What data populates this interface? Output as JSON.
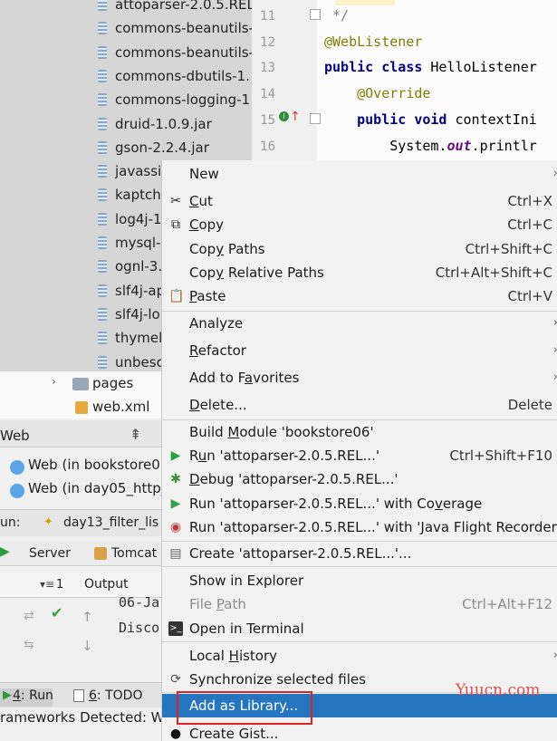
{
  "project_tree": {
    "jars": [
      "attoparser-2.0.5.REL",
      "commons-beanutils-",
      "commons-beanutils-",
      "commons-dbutils-1.",
      "commons-logging-1",
      "druid-1.0.9.jar",
      "gson-2.2.4.jar",
      "javassis",
      "kaptch",
      "log4j-1",
      "mysql-",
      "ognl-3.",
      "slf4j-ap",
      "slf4j-lo",
      "thymel",
      "unbesc"
    ],
    "pages_folder": "pages",
    "web_xml": "web.xml"
  },
  "editor": {
    "line_numbers": [
      "11",
      "12",
      "13",
      "14",
      "15",
      "16"
    ],
    "lines": {
      "l11": " */",
      "l12": "@WebListener",
      "l13_kw": "public class ",
      "l13_name": "HelloListener",
      "l14": "    @Override",
      "l15_kw": "    public void ",
      "l15_name": "contextIni",
      "l16_a": "        System.",
      "l16_b": "out",
      "l16_c": ".printlr"
    }
  },
  "services": {
    "web_panel_title": "Web",
    "items": [
      "Web (in bookstore0",
      "Web (in day05_http_"
    ],
    "run_label": "un:",
    "run_config_tab": "day13_filter_lis",
    "server_tab": "Server",
    "tomcat_tab": "Tomcat L",
    "output_tab": "Output",
    "counter": "1",
    "console_lines": [
      "06-Ja",
      "Disco"
    ]
  },
  "bottom_bar": {
    "run_tab_num": "4",
    "run_tab": ": Run",
    "todo_tab_num": "6",
    "todo_tab": ": TODO",
    "status": "rameworks Detected: We"
  },
  "context_menu": {
    "new": "New",
    "cut_u": "C",
    "cut_rest": "ut",
    "cut_sc": "Ctrl+X",
    "copy_u": "C",
    "copy_rest": "opy",
    "copy_sc": "Ctrl+C",
    "copy_paths_a": "Cop",
    "copy_paths_u": "y",
    "copy_paths_b": " Paths",
    "copy_paths_sc": "Ctrl+Shift+C",
    "copy_rel_a": "Cop",
    "copy_rel_u": "y",
    "copy_rel_b": " Relative Paths",
    "copy_rel_sc": "Ctrl+Alt+Shift+C",
    "paste_u": "P",
    "paste_rest": "aste",
    "paste_sc": "Ctrl+V",
    "analyze": "Analyze",
    "refactor_u": "R",
    "refactor_rest": "efactor",
    "fav_a": "Add to F",
    "fav_u": "a",
    "fav_b": "vorites",
    "delete_u": "D",
    "delete_rest": "elete...",
    "delete_sc": "Delete",
    "build_a": "Build ",
    "build_u": "M",
    "build_b": "odule 'bookstore06'",
    "run_a": "R",
    "run_u": "u",
    "run_b": "n 'attoparser-2.0.5.REL...'",
    "run_sc": "Ctrl+Shift+F10",
    "debug_u": "D",
    "debug_rest": "ebug 'attoparser-2.0.5.REL...'",
    "cov_a": "Run 'attoparser-2.0.5.REL...' with Co",
    "cov_u": "v",
    "cov_b": "erage",
    "jfr": "Run 'attoparser-2.0.5.REL...' with 'Java Flight Recorder'",
    "create": "Create 'attoparser-2.0.5.REL...'...",
    "explorer": "Show in Explorer",
    "file_path_a": "File ",
    "file_path_u": "P",
    "file_path_b": "ath",
    "file_path_sc": "Ctrl+Alt+F12",
    "terminal": "Open in Terminal",
    "history_a": "Local ",
    "history_u": "H",
    "history_b": "istory",
    "sync": "Synchronize selected files",
    "add_lib": "Add as Library...",
    "gist": "Create Gist..."
  },
  "watermark": "Yuucn.com",
  "colors": {
    "selection": "#2675bf",
    "highlight_box": "#e02222"
  }
}
